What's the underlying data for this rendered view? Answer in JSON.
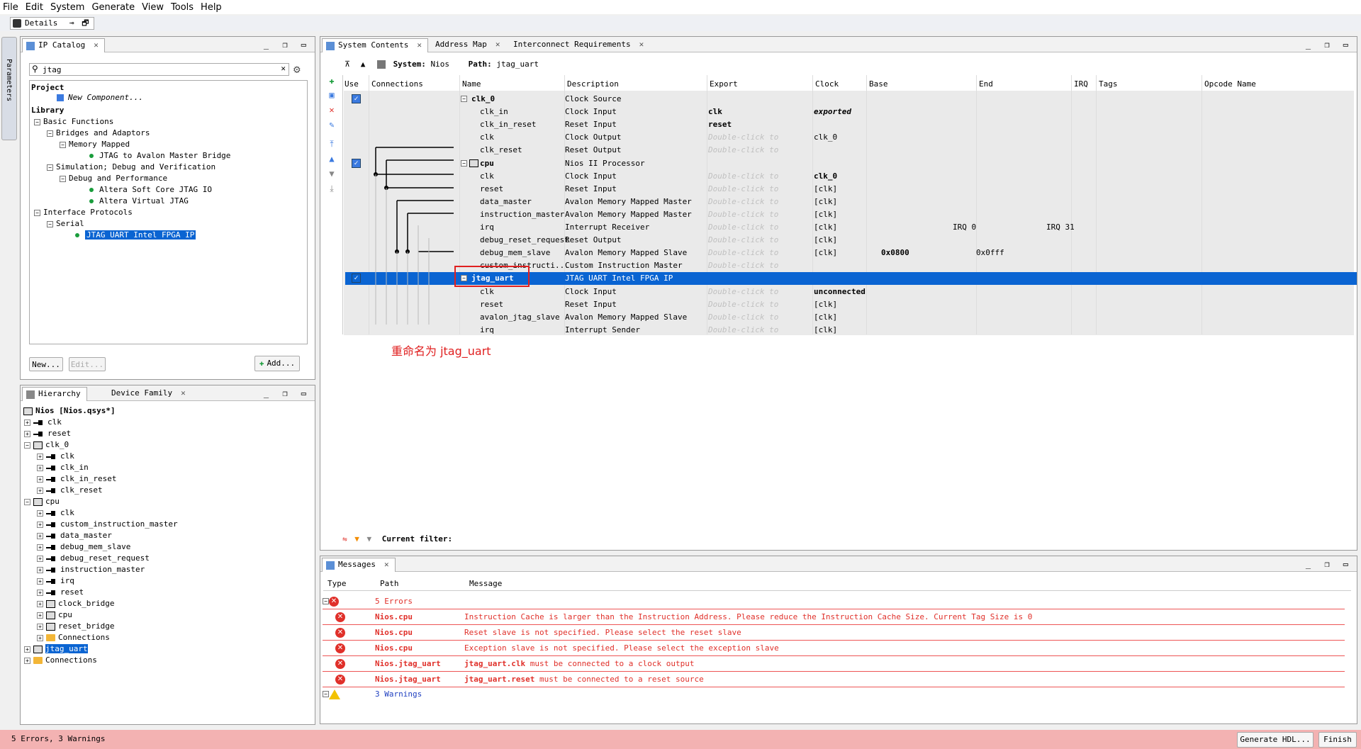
{
  "menu": [
    "File",
    "Edit",
    "System",
    "Generate",
    "View",
    "Tools",
    "Help"
  ],
  "details_tab": "Details",
  "params_vtab": "Parameters",
  "ip_catalog": {
    "tab": "IP Catalog",
    "search_value": "jtag",
    "project": "Project",
    "new_component": "New Component...",
    "library": "Library",
    "tree": [
      "Basic Functions",
      "Bridges and Adaptors",
      "Memory Mapped",
      "JTAG to Avalon Master Bridge",
      "Simulation; Debug and Verification",
      "Debug and Performance",
      "Altera Soft Core JTAG IO",
      "Altera Virtual JTAG",
      "Interface Protocols",
      "Serial",
      "JTAG UART Intel FPGA IP"
    ],
    "new_btn": "New...",
    "edit_btn": "Edit...",
    "add_btn": "Add..."
  },
  "hierarchy": {
    "tab1": "Hierarchy",
    "tab2": "Device Family",
    "root": "Nios [Nios.qsys*]",
    "items": [
      "clk",
      "reset",
      "clk_0",
      "clk",
      "clk_in",
      "clk_in_reset",
      "clk_reset",
      "cpu",
      "clk",
      "custom_instruction_master",
      "data_master",
      "debug_mem_slave",
      "debug_reset_request",
      "instruction_master",
      "irq",
      "reset",
      "clock_bridge",
      "cpu",
      "reset_bridge",
      "Connections",
      "jtag_uart",
      "Connections"
    ]
  },
  "system": {
    "tabs": [
      "System Contents",
      "Address Map",
      "Interconnect Requirements"
    ],
    "system_label": "System:",
    "system_name": "Nios",
    "path_label": "Path:",
    "path_value": "jtag_uart",
    "columns": [
      "Use",
      "Connections",
      "Name",
      "Description",
      "Export",
      "Clock",
      "Base",
      "End",
      "IRQ",
      "Tags",
      "Opcode Name"
    ],
    "rows": [
      {
        "name": "clk_0",
        "desc": "Clock Source",
        "export": "",
        "clock": "",
        "base": "",
        "end": "",
        "irq": ""
      },
      {
        "name": "clk_in",
        "desc": "Clock Input",
        "export": "clk",
        "clock": "exported",
        "base": "",
        "end": "",
        "irq": ""
      },
      {
        "name": "clk_in_reset",
        "desc": "Reset Input",
        "export": "reset",
        "clock": "",
        "base": "",
        "end": "",
        "irq": ""
      },
      {
        "name": "clk",
        "desc": "Clock Output",
        "export": "Double-click to",
        "clock": "clk_0",
        "base": "",
        "end": "",
        "irq": ""
      },
      {
        "name": "clk_reset",
        "desc": "Reset Output",
        "export": "Double-click to",
        "clock": "",
        "base": "",
        "end": "",
        "irq": ""
      },
      {
        "name": "cpu",
        "desc": "Nios II Processor",
        "export": "",
        "clock": "",
        "base": "",
        "end": "",
        "irq": ""
      },
      {
        "name": "clk",
        "desc": "Clock Input",
        "export": "Double-click to",
        "clock": "clk_0",
        "base": "",
        "end": "",
        "irq": ""
      },
      {
        "name": "reset",
        "desc": "Reset Input",
        "export": "Double-click to",
        "clock": "[clk]",
        "base": "",
        "end": "",
        "irq": ""
      },
      {
        "name": "data_master",
        "desc": "Avalon Memory Mapped Master",
        "export": "Double-click to",
        "clock": "[clk]",
        "base": "",
        "end": "",
        "irq": ""
      },
      {
        "name": "instruction_master",
        "desc": "Avalon Memory Mapped Master",
        "export": "Double-click to",
        "clock": "[clk]",
        "base": "",
        "end": "",
        "irq": ""
      },
      {
        "name": "irq",
        "desc": "Interrupt Receiver",
        "export": "Double-click to",
        "clock": "[clk]",
        "base": "IRQ 0",
        "end": "IRQ 31",
        "irq": ""
      },
      {
        "name": "debug_reset_request",
        "desc": "Reset Output",
        "export": "Double-click to",
        "clock": "[clk]",
        "base": "",
        "end": "",
        "irq": ""
      },
      {
        "name": "debug_mem_slave",
        "desc": "Avalon Memory Mapped Slave",
        "export": "Double-click to",
        "clock": "[clk]",
        "base": "0x0800",
        "end": "0x0fff",
        "irq": ""
      },
      {
        "name": "custom_instructi...",
        "desc": "Custom Instruction Master",
        "export": "Double-click to",
        "clock": "",
        "base": "",
        "end": "",
        "irq": ""
      },
      {
        "name": "jtag_uart",
        "desc": "JTAG UART Intel FPGA IP",
        "export": "",
        "clock": "",
        "base": "",
        "end": "",
        "irq": ""
      },
      {
        "name": "clk",
        "desc": "Clock Input",
        "export": "Double-click to",
        "clock": "unconnected",
        "base": "",
        "end": "",
        "irq": ""
      },
      {
        "name": "reset",
        "desc": "Reset Input",
        "export": "Double-click to",
        "clock": "[clk]",
        "base": "",
        "end": "",
        "irq": ""
      },
      {
        "name": "avalon_jtag_slave",
        "desc": "Avalon Memory Mapped Slave",
        "export": "Double-click to",
        "clock": "[clk]",
        "base": "",
        "end": "",
        "irq": ""
      },
      {
        "name": "irq",
        "desc": "Interrupt Sender",
        "export": "Double-click to",
        "clock": "[clk]",
        "base": "",
        "end": "",
        "irq": ""
      }
    ],
    "annotation": "重命名为 jtag_uart",
    "filter_label": "Current filter:"
  },
  "messages": {
    "tab": "Messages",
    "columns": [
      "Type",
      "Path",
      "Message"
    ],
    "errors_header": "5 Errors",
    "errors": [
      {
        "path": "Nios.cpu",
        "msg": "Instruction Cache is larger than the Instruction Address. Please reduce the Instruction Cache Size. Current Tag Size is 0"
      },
      {
        "path": "Nios.cpu",
        "msg": "Reset slave is not specified. Please select the reset slave"
      },
      {
        "path": "Nios.cpu",
        "msg": "Exception slave is not specified. Please select the exception slave"
      },
      {
        "path": "Nios.jtag_uart",
        "msg_bold": "jtag_uart.clk",
        "msg": " must be connected to a clock output"
      },
      {
        "path": "Nios.jtag_uart",
        "msg_bold": "jtag_uart.reset",
        "msg": " must be connected to a reset source"
      }
    ],
    "warnings_header": "3 Warnings"
  },
  "status": {
    "text": "5 Errors, 3 Warnings",
    "generate_btn": "Generate HDL...",
    "finish_btn": "Finish"
  },
  "colors": {
    "accent": "#0a64d2",
    "error": "#e0302a",
    "status_bg": "#f3b2b2"
  }
}
